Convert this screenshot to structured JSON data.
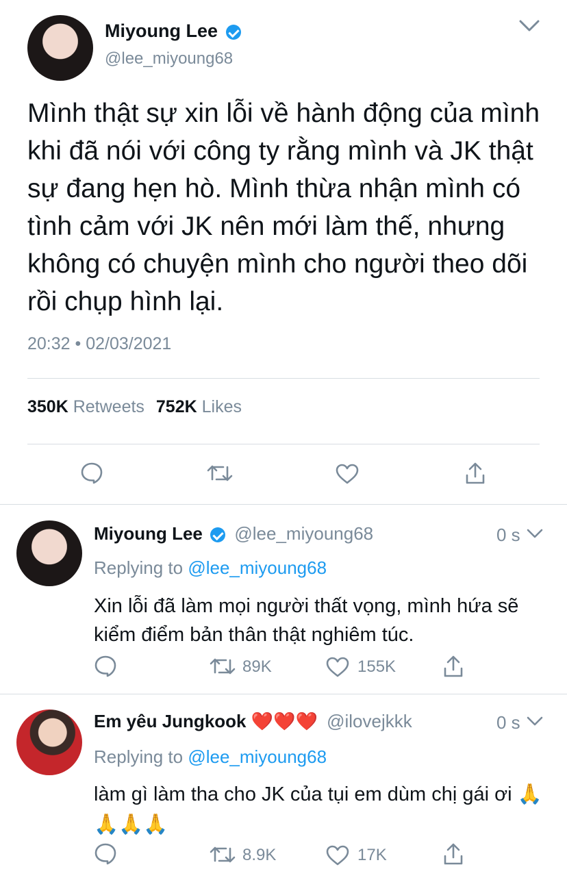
{
  "main_tweet": {
    "author": {
      "name": "Miyoung Lee",
      "handle": "@lee_miyoung68",
      "verified": true
    },
    "text": "Mình thật sự xin lỗi về hành động của mình khi đã nói với công ty rằng mình và JK thật sự đang hẹn hò. Mình thừa nhận mình có tình cảm với JK nên mới làm thế, nhưng không có chuyện mình cho người theo dõi rồi chụp hình lại.",
    "timestamp": "20:32 • 02/03/2021",
    "stats": {
      "retweets_count": "350K",
      "retweets_label": "Retweets",
      "likes_count": "752K",
      "likes_label": "Likes"
    }
  },
  "replies": [
    {
      "name": "Miyoung Lee",
      "verified": true,
      "handle": "@lee_miyoung68",
      "time": "0 s",
      "replying_prefix": "Replying to",
      "replying_to": "@lee_miyoung68",
      "text": "Xin lỗi đã làm mọi người thất vọng, mình hứa sẽ kiểm điểm bản thân thật nghiêm túc.",
      "retweets": "89K",
      "likes": "155K"
    },
    {
      "name": "Em yêu Jungkook ❤️❤️❤️",
      "verified": false,
      "handle": "@ilovejkkk",
      "time": "0 s",
      "replying_prefix": "Replying to",
      "replying_to": "@lee_miyoung68",
      "text": "làm gì làm tha cho JK của tụi em dùm chị gái ơi 🙏🙏🙏🙏",
      "retweets": "8.9K",
      "likes": "17K"
    }
  ],
  "icons": {
    "reply": "speech-bubble",
    "retweet": "retweet-arrows",
    "like": "heart",
    "share": "share-arrow",
    "caret": "chevron-down"
  },
  "colors": {
    "accent": "#1d9bf0",
    "muted": "#7a8a99",
    "text": "#0f1419",
    "divider": "#d8dde2"
  }
}
